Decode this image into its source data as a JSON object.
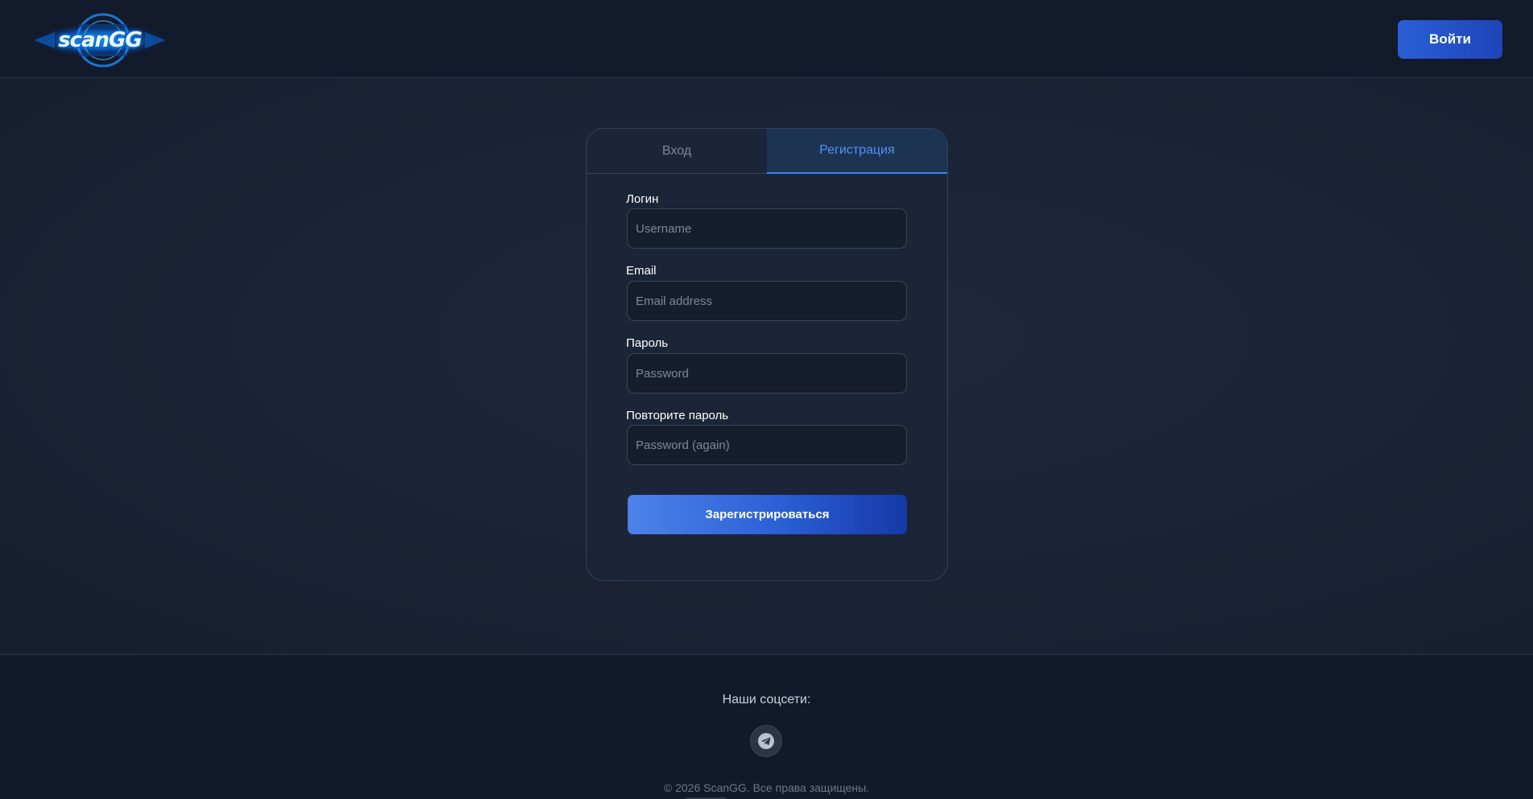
{
  "header": {
    "logo_text": "scanGG",
    "login_button": "Войти"
  },
  "auth_card": {
    "tabs": {
      "login": "Вход",
      "register": "Регистрация",
      "active": "register"
    },
    "fields": {
      "username": {
        "label": "Логин",
        "placeholder": "Username",
        "value": ""
      },
      "email": {
        "label": "Email",
        "placeholder": "Email address",
        "value": ""
      },
      "password": {
        "label": "Пароль",
        "placeholder": "Password",
        "value": ""
      },
      "password_again": {
        "label": "Повторите пароль",
        "placeholder": "Password (again)",
        "value": ""
      }
    },
    "submit_button": "Зарегистрироваться"
  },
  "footer": {
    "social_title": "Наши соцсети:",
    "social_icons": [
      "telegram-icon"
    ],
    "copyright": "© 2026 ScanGG. Все права защищены."
  },
  "colors": {
    "accent": "#3b86f0",
    "button_gradient_start": "#4d82ea",
    "button_gradient_end": "#1539a8",
    "background": "#1a2335",
    "header_background": "#121a2b"
  }
}
